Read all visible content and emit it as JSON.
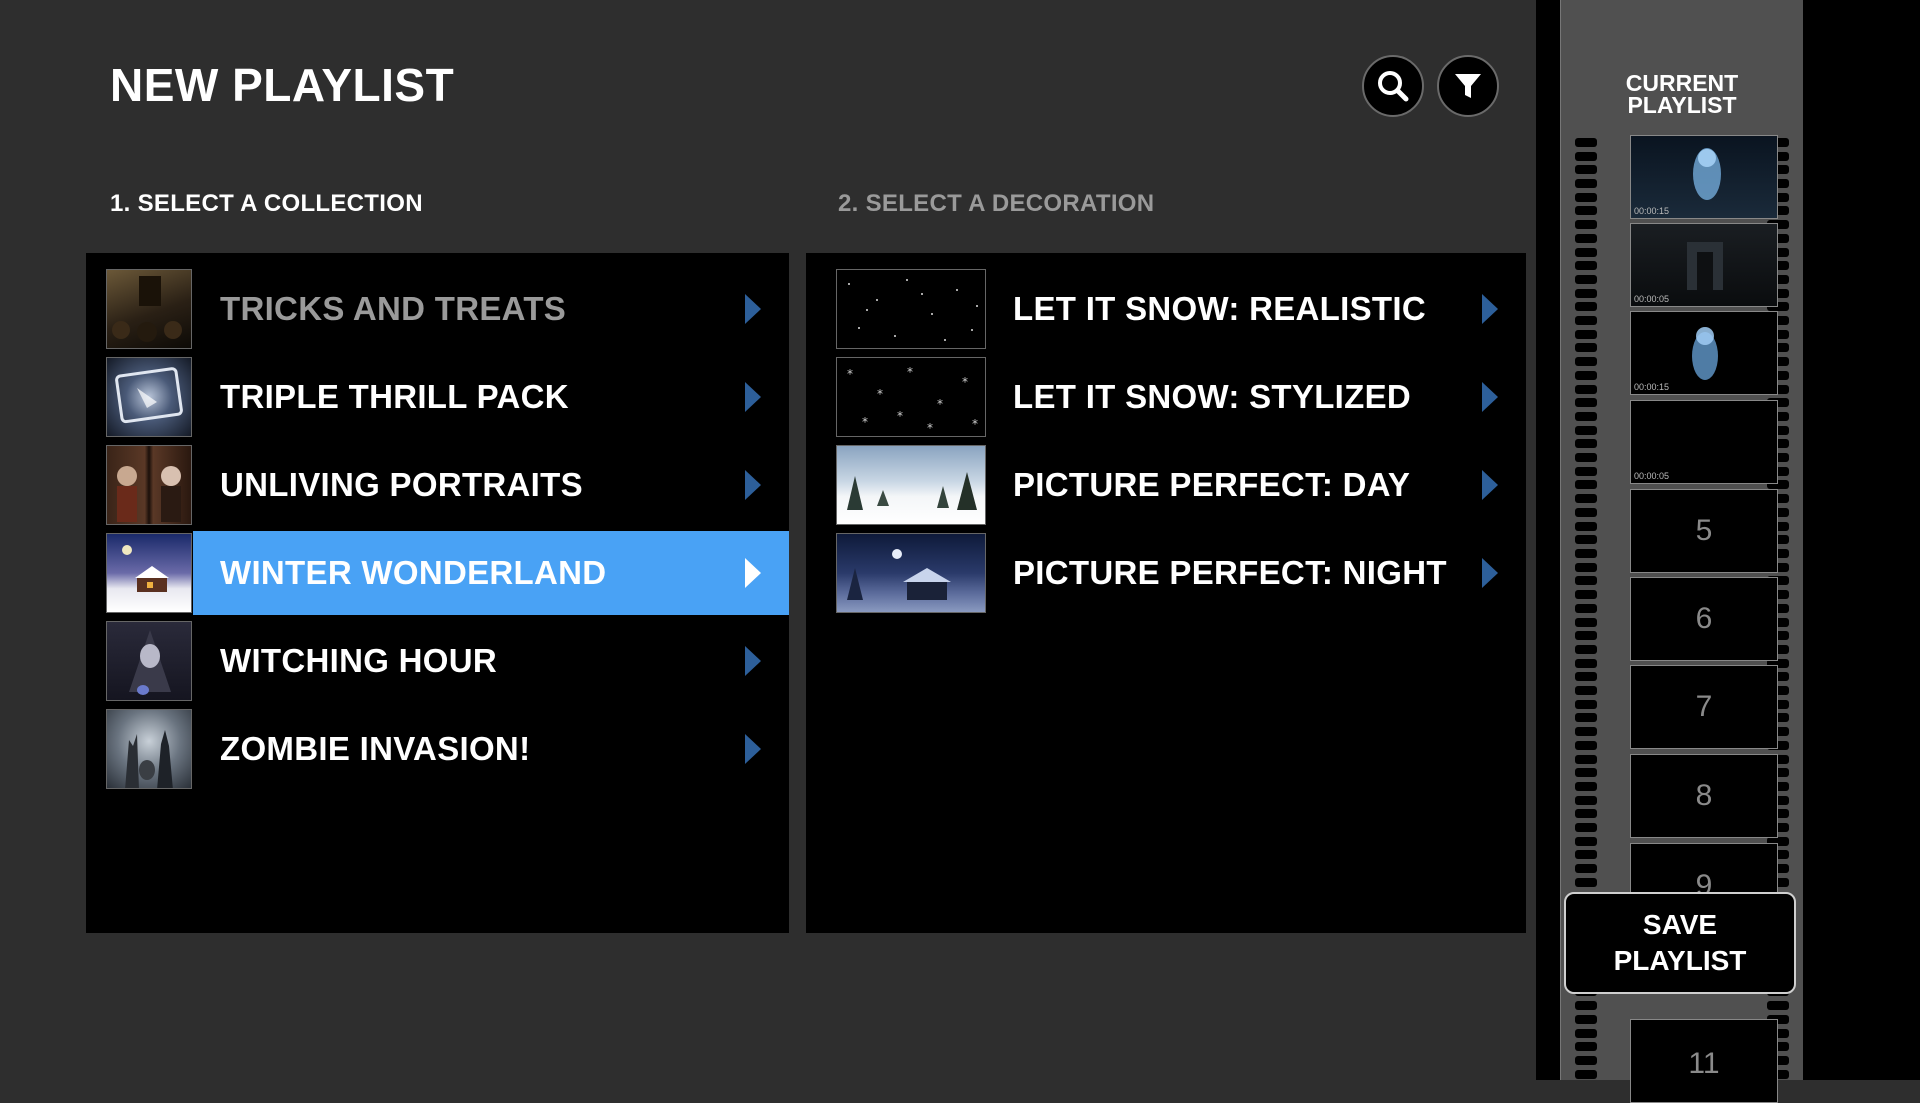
{
  "header": {
    "title": "NEW PLAYLIST",
    "search_icon": "search-icon",
    "filter_icon": "filter-icon"
  },
  "collections": {
    "label": "1. SELECT A COLLECTION",
    "items": [
      {
        "label": "TRICKS AND TREATS",
        "dim": true
      },
      {
        "label": "TRIPLE THRILL PACK"
      },
      {
        "label": "UNLIVING PORTRAITS"
      },
      {
        "label": "WINTER WONDERLAND",
        "selected": true
      },
      {
        "label": "WITCHING HOUR"
      },
      {
        "label": "ZOMBIE INVASION!"
      }
    ]
  },
  "decorations": {
    "label": "2. SELECT A DECORATION",
    "items": [
      {
        "label": "LET IT SNOW: REALISTIC"
      },
      {
        "label": "LET IT SNOW: STYLIZED"
      },
      {
        "label": "PICTURE PERFECT: DAY"
      },
      {
        "label": "PICTURE PERFECT: NIGHT"
      }
    ]
  },
  "playlist": {
    "title_line1": "CURRENT",
    "title_line2": "PLAYLIST",
    "frames": [
      {
        "time": "00:00:15"
      },
      {
        "time": "00:00:05"
      },
      {
        "time": "00:00:15"
      },
      {
        "time": "00:00:05"
      },
      {
        "num": "5"
      },
      {
        "num": "6"
      },
      {
        "num": "7"
      },
      {
        "num": "8"
      },
      {
        "num": "9"
      },
      {
        "num": "11"
      }
    ],
    "save_line1": "SAVE",
    "save_line2": "PLAYLIST"
  },
  "colors": {
    "accent": "#49a2f5",
    "chevron": "#2d5f9a",
    "background": "#2e2e2e"
  }
}
